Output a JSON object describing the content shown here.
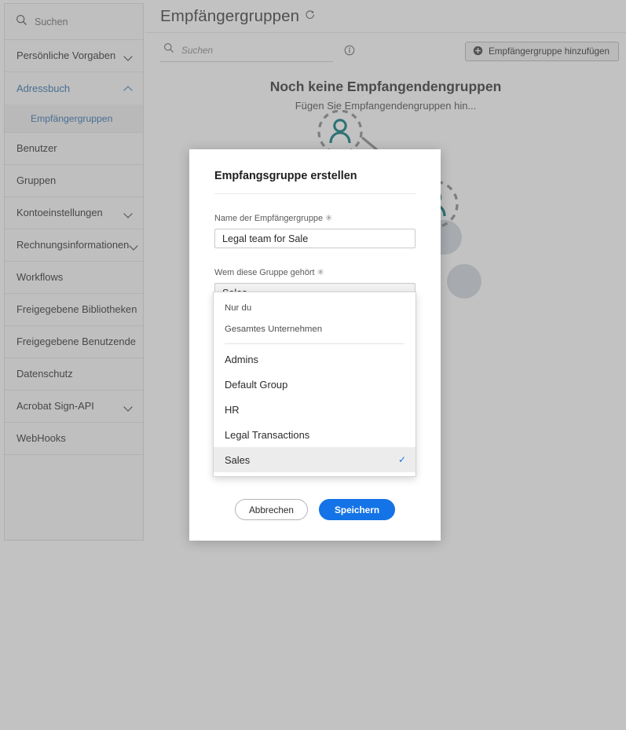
{
  "sidebar": {
    "search_placeholder": "Suchen",
    "items": [
      {
        "label": "Persönliche Vorgaben",
        "chevron": "chevron-down-icon",
        "state": "collapsed",
        "accent": false
      },
      {
        "label": "Adressbuch",
        "chevron": "chevron-up-icon",
        "state": "expanded",
        "accent": true
      },
      {
        "label": "Benutzer",
        "chevron": "",
        "state": "leaf",
        "accent": false
      },
      {
        "label": "Gruppen",
        "chevron": "",
        "state": "leaf",
        "accent": false
      },
      {
        "label": "Kontoeinstellungen",
        "chevron": "chevron-down-icon",
        "state": "collapsed",
        "accent": false
      },
      {
        "label": "Rechnungsinformationen",
        "chevron": "chevron-down-icon",
        "state": "collapsed",
        "accent": false
      },
      {
        "label": "Workflows",
        "chevron": "",
        "state": "leaf",
        "accent": false
      },
      {
        "label": "Freigegebene Bibliotheken",
        "chevron": "",
        "state": "leaf",
        "accent": false
      },
      {
        "label": "Freigegebene Benutzende",
        "chevron": "",
        "state": "leaf",
        "accent": false
      },
      {
        "label": "Datenschutz",
        "chevron": "",
        "state": "leaf",
        "accent": false
      },
      {
        "label": "Acrobat Sign-API",
        "chevron": "chevron-down-icon",
        "state": "collapsed",
        "accent": false
      },
      {
        "label": "WebHooks",
        "chevron": "",
        "state": "leaf",
        "accent": false
      }
    ],
    "subitem": {
      "label": "Empfängergruppen",
      "active": true
    }
  },
  "header": {
    "title": "Empfängergruppen",
    "refresh_icon": "refresh-icon"
  },
  "toolbar": {
    "search_placeholder": "Suchen",
    "search_value": "",
    "search_icon": "search-icon",
    "info_icon": "info-circle-icon",
    "add_button_label": "Empfängergruppe hinzufügen",
    "add_button_icon": "plus-circle-icon"
  },
  "empty_state": {
    "heading": "Noch keine Empfangendengruppen",
    "subtext": "Fügen Sie Empfangendengruppen hin...",
    "illustration": "people-network-illustration"
  },
  "modal": {
    "title": "Empfangsgruppe erstellen",
    "name_field": {
      "label": "Name der Empfängergruppe",
      "required_marker": "✳",
      "value": "Legal team for Sale",
      "placeholder": ""
    },
    "owner_field": {
      "label": "Wem diese Gruppe gehört",
      "required_marker": "✳",
      "selected": "Sales",
      "chevron": "chevron-down-icon"
    },
    "dropdown": {
      "open": true,
      "special_options": [
        {
          "label": "Nur du",
          "selected": false
        },
        {
          "label": "Gesamtes Unternehmen",
          "selected": false
        }
      ],
      "group_options": [
        {
          "label": "Admins",
          "selected": false
        },
        {
          "label": "Default Group",
          "selected": false
        },
        {
          "label": "HR",
          "selected": false
        },
        {
          "label": "Legal Transactions",
          "selected": false
        },
        {
          "label": "Sales",
          "selected": true
        }
      ],
      "check_glyph": "✓"
    },
    "cancel_label": "Abbrechen",
    "save_label": "Speichern"
  },
  "colors": {
    "accent_blue": "#1473e6",
    "sidebar_link": "#2e6fab",
    "overlay": "rgba(110,110,110,.42)",
    "illustration_teal": "#00767a",
    "illustration_blob": "#aab7c4"
  }
}
